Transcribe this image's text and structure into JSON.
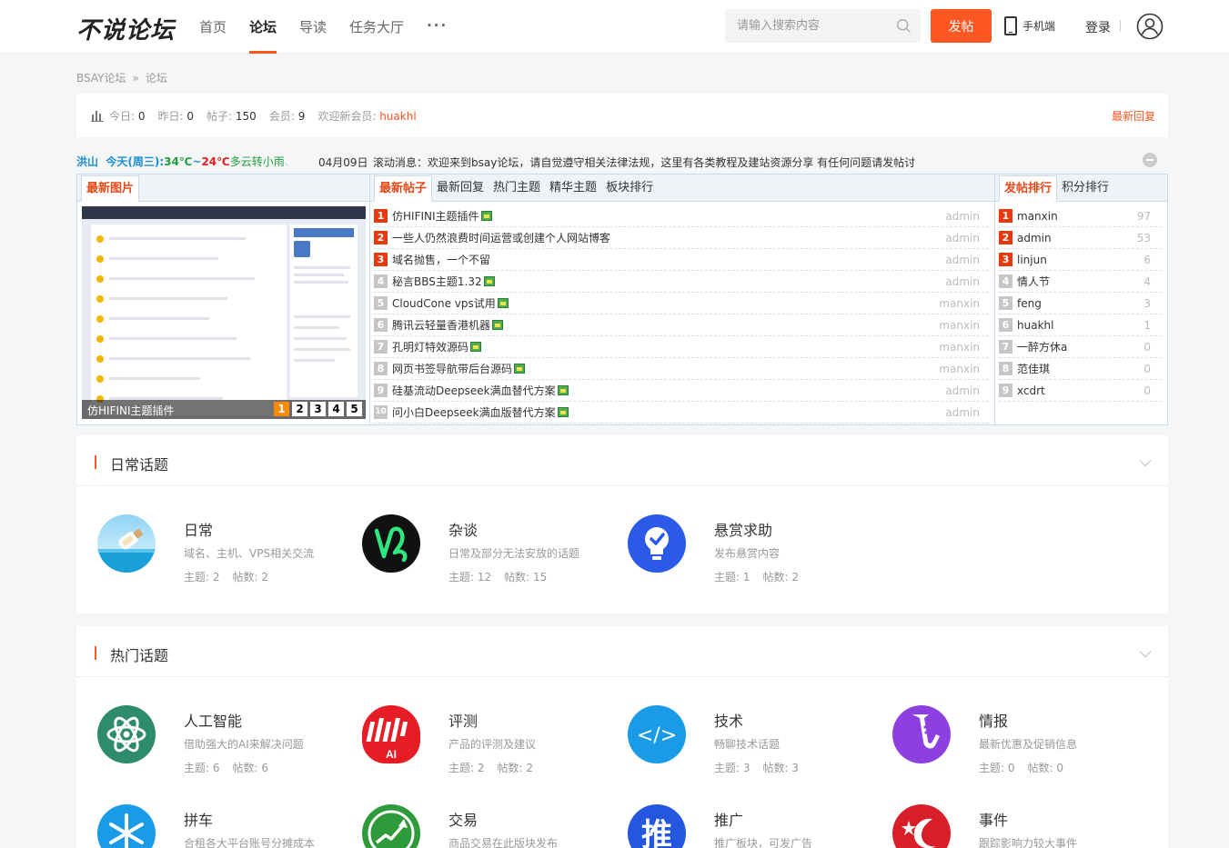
{
  "header": {
    "logo": "不说论坛",
    "nav": [
      {
        "label": "首页",
        "active": false
      },
      {
        "label": "论坛",
        "active": true
      },
      {
        "label": "导读",
        "active": false
      },
      {
        "label": "任务大厅",
        "active": false
      }
    ],
    "more": "···",
    "search_placeholder": "请输入搜索内容",
    "post_button": "发帖",
    "mobile": "手机端",
    "login": "登录"
  },
  "breadcrumb": {
    "home": "BSAY论坛",
    "sep": "»",
    "current": "论坛"
  },
  "stats": {
    "today_label": "今日:",
    "today": "0",
    "yesterday_label": "昨日:",
    "yesterday": "0",
    "posts_label": "帖子:",
    "posts": "150",
    "members_label": "会员:",
    "members": "9",
    "welcome_label": "欢迎新会员:",
    "new_member": "huakhl",
    "latest_reply": "最新回复"
  },
  "ticker": {
    "city": "洪山",
    "day": "今天(周三):",
    "high": "34℃",
    "tilde": "~",
    "low": "24℃",
    "desc": "多云转小雨",
    "fade": "、",
    "date": "04月09日",
    "message": "滚动消息：欢迎来到bsay论坛，请自觉遵守相关法律法规，这里有各类教程及建站资源分享    有任何问题请发帖讨"
  },
  "portal": {
    "images_tab": "最新图片",
    "slide_caption": "仿HIFINI主题插件",
    "slide_pages": [
      "1",
      "2",
      "3",
      "4",
      "5"
    ],
    "threads_tabs": [
      "最新帖子",
      "最新回复",
      "热门主题",
      "精华主题",
      "板块排行"
    ],
    "threads": [
      {
        "n": "1",
        "title": "仿HIFINI主题插件",
        "author": "admin"
      },
      {
        "n": "2",
        "title": "一些人仍然浪费时间运营或创建个人网站博客",
        "author": "admin"
      },
      {
        "n": "3",
        "title": "域名抛售，一个不留",
        "author": "admin"
      },
      {
        "n": "4",
        "title": "秘言BBS主题1.32",
        "author": "admin"
      },
      {
        "n": "5",
        "title": "CloudCone vps试用",
        "author": "manxin"
      },
      {
        "n": "6",
        "title": "腾讯云轻量香港机器",
        "author": "manxin"
      },
      {
        "n": "7",
        "title": "孔明灯特效源码",
        "author": "manxin"
      },
      {
        "n": "8",
        "title": "网页书签导航带后台源码",
        "author": "manxin"
      },
      {
        "n": "9",
        "title": "硅基流动Deepseek满血替代方案",
        "author": "admin"
      },
      {
        "n": "10",
        "title": "问小白Deepseek满血版替代方案",
        "author": "admin"
      }
    ],
    "rank_tabs": [
      "发帖排行",
      "积分排行"
    ],
    "ranking": [
      {
        "n": "1",
        "name": "manxin",
        "score": "97"
      },
      {
        "n": "2",
        "name": "admin",
        "score": "53"
      },
      {
        "n": "3",
        "name": "linjun",
        "score": "6"
      },
      {
        "n": "4",
        "name": "情人节",
        "score": "4"
      },
      {
        "n": "5",
        "name": "feng",
        "score": "3"
      },
      {
        "n": "6",
        "name": "huakhl",
        "score": "1"
      },
      {
        "n": "7",
        "name": "一醉方休a",
        "score": "0"
      },
      {
        "n": "8",
        "name": "范佳琪",
        "score": "0"
      },
      {
        "n": "9",
        "name": "xcdrt",
        "score": "0"
      }
    ]
  },
  "sections": {
    "daily": {
      "title": "日常话题",
      "forums": [
        {
          "name": "日常",
          "desc": "域名、主机、VPS相关交流",
          "threads_label": "主题:",
          "threads": "2",
          "posts_label": "帖数:",
          "posts": "2"
        },
        {
          "name": "杂谈",
          "desc": "日常及部分无法安放的话题",
          "threads_label": "主题:",
          "threads": "12",
          "posts_label": "帖数:",
          "posts": "15"
        },
        {
          "name": "悬赏求助",
          "desc": "发布悬赏内容",
          "threads_label": "主题:",
          "threads": "1",
          "posts_label": "帖数:",
          "posts": "2"
        }
      ]
    },
    "hot": {
      "title": "热门话题",
      "forums": [
        {
          "name": "人工智能",
          "desc": "借助强大的AI来解决问题",
          "threads_label": "主题:",
          "threads": "6",
          "posts_label": "帖数:",
          "posts": "6"
        },
        {
          "name": "评测",
          "desc": "产品的评测及建议",
          "threads_label": "主题:",
          "threads": "2",
          "posts_label": "帖数:",
          "posts": "2"
        },
        {
          "name": "技术",
          "desc": "畅聊技术话题",
          "threads_label": "主题:",
          "threads": "3",
          "posts_label": "帖数:",
          "posts": "3"
        },
        {
          "name": "情报",
          "desc": "最新优惠及促销信息",
          "threads_label": "主题:",
          "threads": "0",
          "posts_label": "帖数:",
          "posts": "0"
        },
        {
          "name": "拼车",
          "desc": "合租各大平台账号分摊成本"
        },
        {
          "name": "交易",
          "desc": "商品交易在此版块发布"
        },
        {
          "name": "推广",
          "desc": "推广板块，可发广告"
        },
        {
          "name": "事件",
          "desc": "跟踪影响力较大事件"
        }
      ]
    }
  },
  "icon_text": {
    "ai_badge": "AI",
    "tech_code": "</>",
    "promo_char": "推"
  },
  "colors": {
    "accent": "#ff5722",
    "portal_border": "#c9dbea",
    "rank_red": "#e8380d"
  }
}
